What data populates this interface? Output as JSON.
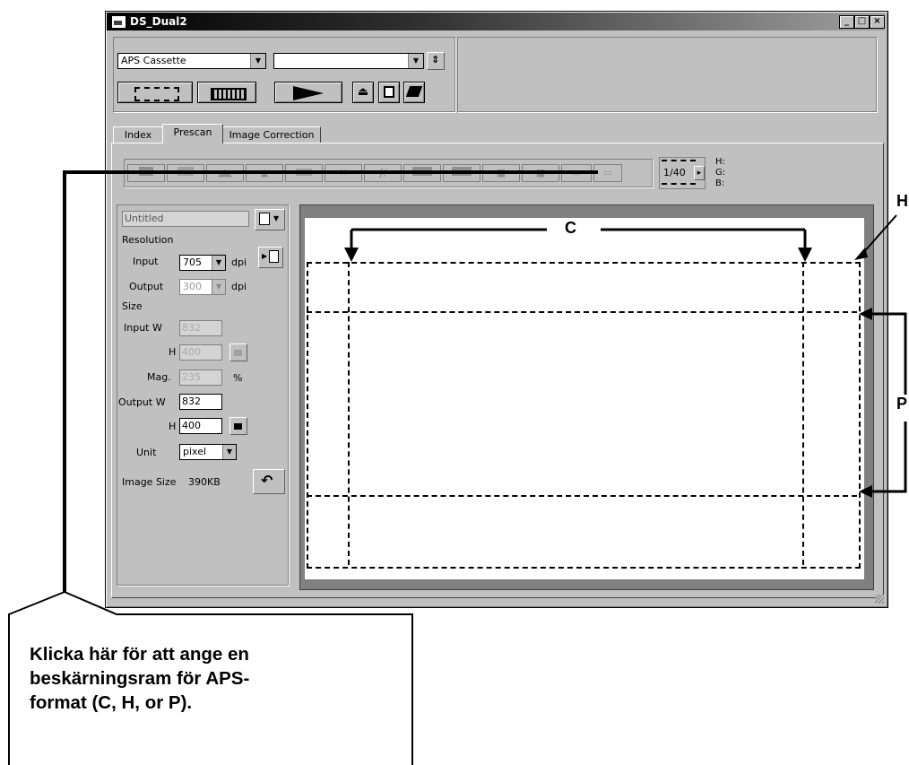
{
  "window": {
    "title": "DS_Dual2",
    "minimize": "_",
    "maximize": "□",
    "close": "×"
  },
  "toolbar": {
    "film_type_value": "APS Cassette",
    "second_combo_value": "",
    "eject_glyph": "⏏"
  },
  "tabs": [
    {
      "label": "Index",
      "active": false
    },
    {
      "label": "Prescan",
      "active": true
    },
    {
      "label": "Image Correction",
      "active": false
    }
  ],
  "tool_icons": [
    "select-tool-icon",
    "crop-tool-icon",
    "flip-tool-icon",
    "rotate-tool-icon",
    "mirror-tool-icon",
    "zoom-tool-icon",
    "eyedropper-tool-icon",
    "gray-tool-icon",
    "black-tool-icon",
    "auto-tool-icon",
    "reset-tool-icon",
    "frame-tool-icon",
    "aps-frame-tool-icon"
  ],
  "frame_counter": {
    "value": "1/40",
    "next": "▸"
  },
  "rgb_readout": {
    "r_label": "H:",
    "g_label": "G:",
    "b_label": "B:"
  },
  "settings": {
    "job_name": "Untitled",
    "resolution_label": "Resolution",
    "input_label": "Input",
    "input_dpi": "705",
    "dpi_unit": "dpi",
    "output_label": "Output",
    "output_dpi": "300",
    "size_label": "Size",
    "input_w_label": "Input W",
    "input_w": "832",
    "h_label": "H",
    "input_h": "400",
    "mag_label": "Mag.",
    "mag": "235",
    "percent": "%",
    "output_w_label": "Output W",
    "output_w": "832",
    "output_h": "400",
    "unit_label": "Unit",
    "unit_value": "pixel",
    "image_size_label": "Image Size",
    "image_size_value": "390KB"
  },
  "annotations": {
    "c_label": "C",
    "h_label": "H",
    "p_label": "P",
    "callout": [
      "Klicka här för att ange en",
      "beskärningsram för APS-",
      "format (C, H, or P)."
    ]
  }
}
